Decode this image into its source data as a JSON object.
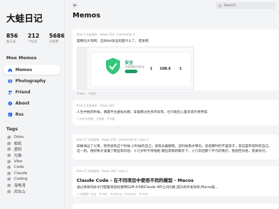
{
  "sidebar": {
    "brand": "大蛙日记",
    "stats": [
      {
        "value": "856",
        "label": "备忘录"
      },
      {
        "value": "212",
        "label": "个标签"
      },
      {
        "value": "5686",
        "label": "天使用"
      }
    ],
    "section_title": "Moe Memos",
    "nav": [
      {
        "label": "Memos",
        "icon": "home-icon"
      },
      {
        "label": "Photography",
        "icon": "image-icon"
      },
      {
        "label": "Friend",
        "icon": "users-icon"
      },
      {
        "label": "About",
        "icon": "info-icon"
      },
      {
        "label": "Rss",
        "icon": "rss-icon"
      }
    ],
    "tags_title": "Tags",
    "tags": [
      "Ddos",
      "相机",
      "虚拟",
      "光猫",
      "Vibe",
      "Code",
      "Claude",
      "Coding",
      "海龟湾",
      "风车山"
    ]
  },
  "main": {
    "title": "Memos",
    "search_placeholder": "Search"
  },
  "memos": [
    {
      "meta": "Post 3 天前发布 · Views 119 · Comments 3",
      "text": "是哪位大哥啊，这ddos攻击的是什么了，得坐啊.",
      "screenshot": {
        "status": "安全",
        "sub": "当前网络环境安全",
        "numbers": [
          "1",
          "108.6",
          "1"
        ]
      },
      "tags": [
        "#ddos",
        "#相机"
      ]
    },
    {
      "meta": "Post 3 天前发布 · Views 101",
      "text": "人生中拍的时候，偶遇平台虚拟光圈，拿着那过往多的背景，也只能在心里没说为感觉得.",
      "tags": [
        "广州市光明路",
        "#虚拟",
        "#光猫"
      ]
    },
    {
      "meta": "Post 17 天前发布 · Views 376 · Comments 8 · Likes 1",
      "text": "如果海边了父亲，突然发现这个时候 小时候的自己，发现光着脚跑，这时候我才明白，爸爸那时的不是孩子，其实是年轻时的自己。",
      "text2": "这一刻，我好像才读懂了那些年的他：十几岁时不停地跑 那些奔跑的脚步下，十几年后那个平凡的我们，我想告诉他，我爱你们。",
      "tags": []
    },
    {
      "meta": "Post 17 天前发布 · Views 363 · Likes 2",
      "title": "Claude Code - 在不同项目中使用不同的模型 - Macos",
      "text": "通过简单的命令行配置来轻松使用GLM-4.6和Claude API之间切换,提升AI开发效率,Macos篇...",
      "tags": [
        "广州增城广东省",
        "#vibe",
        "#coding",
        "#claude",
        "#code"
      ]
    }
  ]
}
